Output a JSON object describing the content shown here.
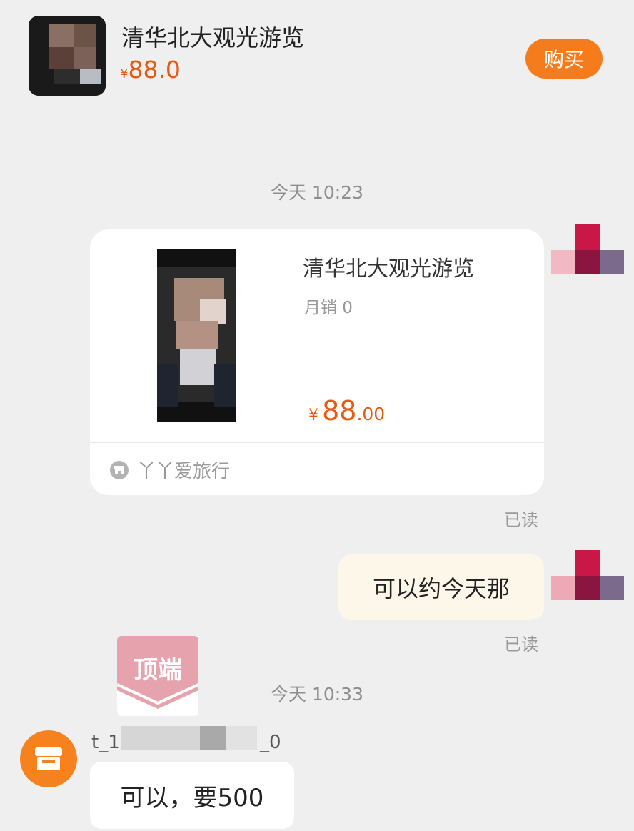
{
  "header": {
    "product_title": "清华北大观光游览",
    "currency": "¥",
    "price": "88.0",
    "buy_label": "购买"
  },
  "messages": {
    "timestamp_1": "今天 10:23",
    "timestamp_2": "今天 10:33",
    "read_1": "已读",
    "read_2": "已读",
    "outgoing_text": "可以约今天那",
    "sender_prefix": "t_1",
    "sender_suffix": "_0",
    "incoming_text": "可以，要500"
  },
  "product_card": {
    "title": "清华北大观光游览",
    "sales": "月销 0",
    "currency": "¥",
    "price_int": "88",
    "price_dec": ".00",
    "shop_name": "丫丫爱旅行"
  },
  "watermark": {
    "text": "顶端"
  },
  "colors": {
    "accent": "#f57c1c",
    "price": "#e55b12",
    "background": "#efefef",
    "outgoing_bubble": "#fdf7ea"
  }
}
